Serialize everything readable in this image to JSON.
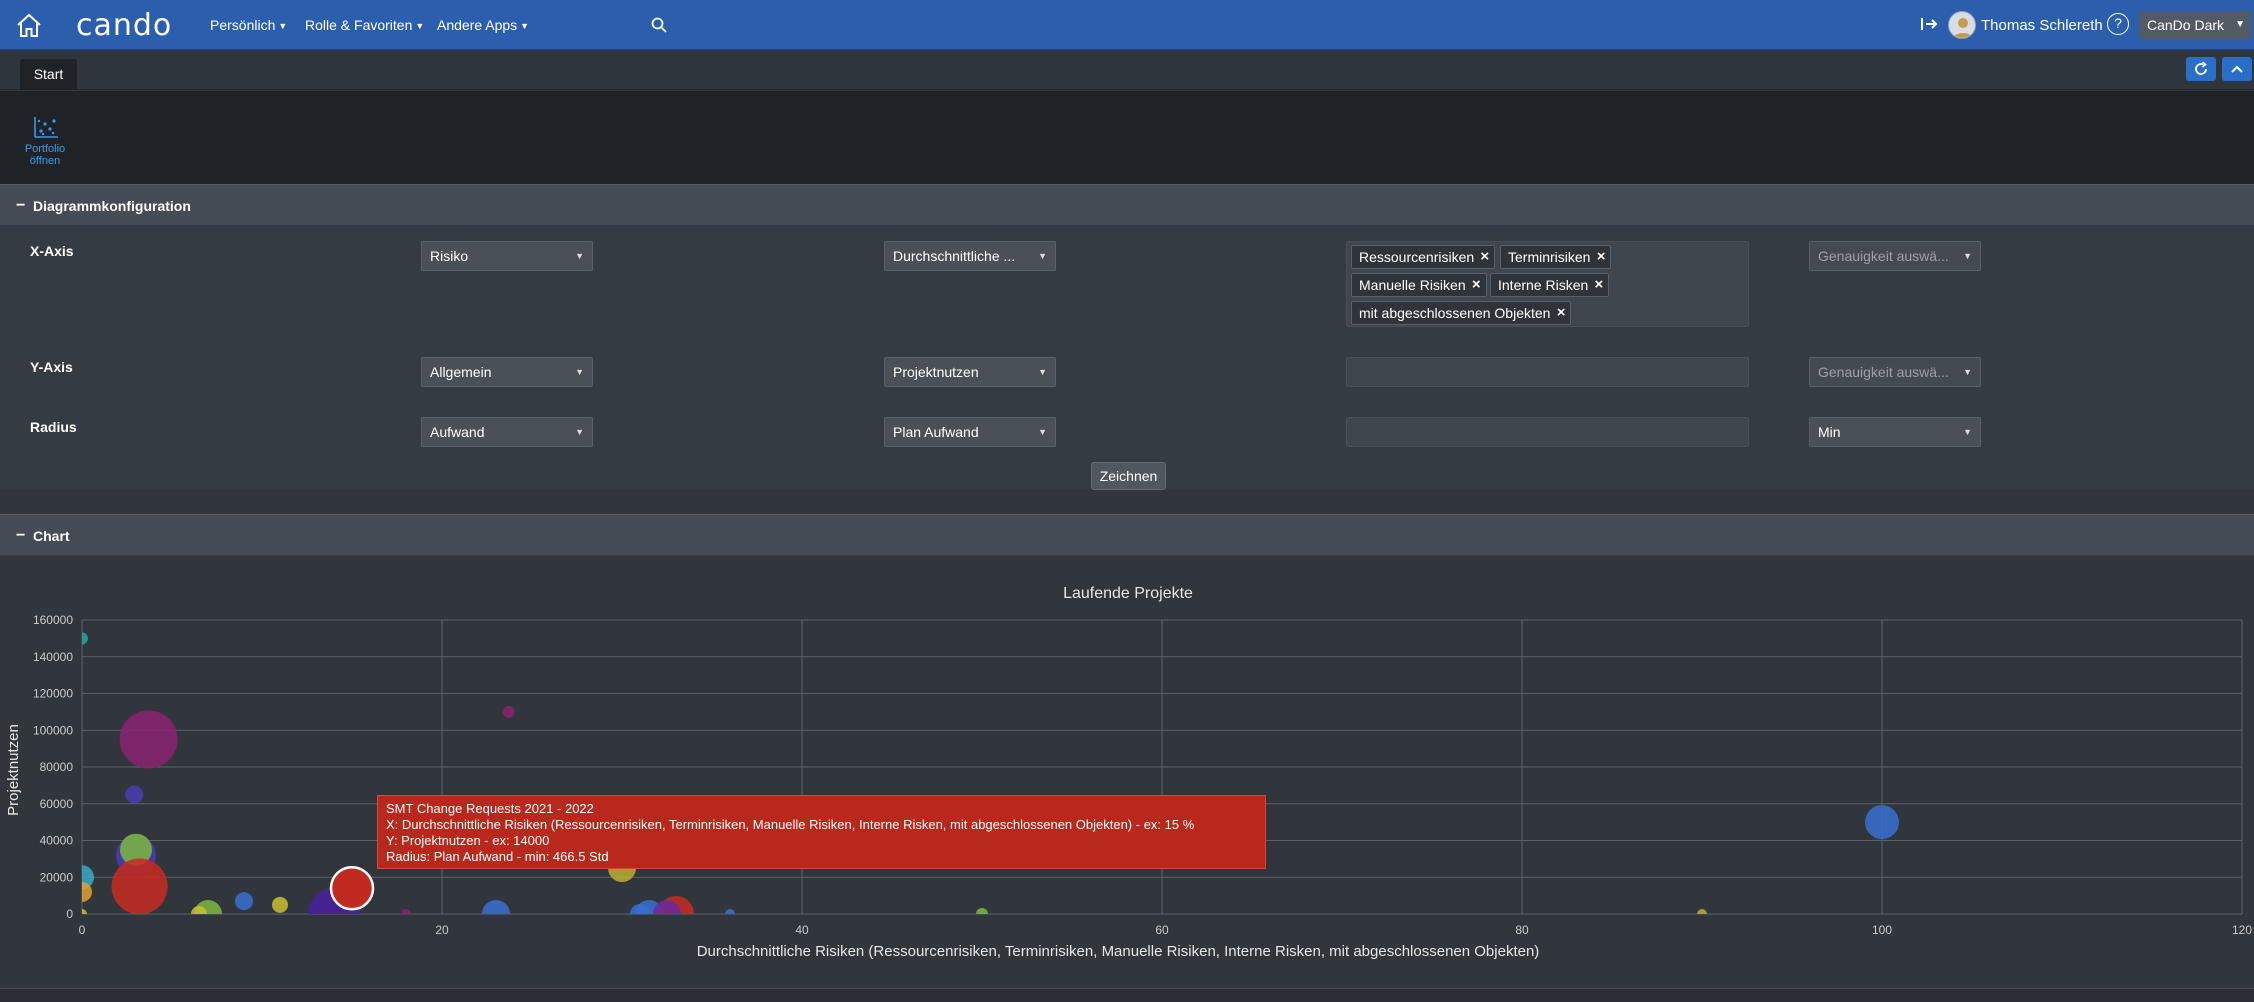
{
  "topbar": {
    "logo": "cando",
    "nav": [
      {
        "label": "Persönlich"
      },
      {
        "label": "Rolle & Favoriten"
      },
      {
        "label": "Andere Apps"
      }
    ],
    "user_name": "Thomas Schlereth",
    "help_glyph": "?",
    "theme_label": "CanDo Dark",
    "icons": [
      "home-icon",
      "search-icon",
      "logout-icon",
      "user-avatar-icon",
      "help-icon",
      "chevron-down-icon"
    ]
  },
  "tabs": [
    {
      "label": "Start"
    }
  ],
  "tabbar_icons": [
    "refresh-icon",
    "collapse-up-icon"
  ],
  "launcher": {
    "label_line1": "Portfolio",
    "label_line2": "öffnen",
    "icon": "scatter-chart-icon"
  },
  "config": {
    "title": "Diagrammkonfiguration",
    "collapse_glyph": "−",
    "rows": {
      "x": {
        "label": "X-Axis",
        "category": "Risiko",
        "metric": "Durchschnittliche ...",
        "tags": [
          "Ressourcenrisiken",
          "Terminrisiken",
          "Manuelle Risiken",
          "Interne Risken",
          "mit abgeschlossenen Objekten"
        ],
        "precision_placeholder": "Genauigkeit auswä..."
      },
      "y": {
        "label": "Y-Axis",
        "category": "Allgemein",
        "metric": "Projektnutzen",
        "precision_placeholder": "Genauigkeit auswä..."
      },
      "r": {
        "label": "Radius",
        "category": "Aufwand",
        "metric": "Plan Aufwand",
        "aggregation": "Min"
      }
    },
    "draw_button": "Zeichnen"
  },
  "chart_section": {
    "title": "Chart",
    "collapse_glyph": "−"
  },
  "chart_data": {
    "type": "scatter",
    "title": "Laufende Projekte",
    "xlabel": "Durchschnittliche Risiken (Ressourcenrisiken, Terminrisiken, Manuelle Risiken, Interne Risken, mit abgeschlossenen Objekten)",
    "ylabel": "Projektnutzen",
    "xlim": [
      0,
      120
    ],
    "ylim": [
      0,
      160000
    ],
    "xticks": [
      0,
      20,
      40,
      60,
      80,
      100,
      120
    ],
    "yticks": [
      0,
      20000,
      40000,
      60000,
      80000,
      100000,
      120000,
      140000,
      160000
    ],
    "grid": true,
    "points": [
      {
        "x": 0,
        "y": 150000,
        "r": 6,
        "color": "#2aa5a0"
      },
      {
        "x": 0,
        "y": 20000,
        "r": 12,
        "color": "#3aa8c8"
      },
      {
        "x": 0,
        "y": 12000,
        "r": 10,
        "color": "#e0a030"
      },
      {
        "x": 0,
        "y": 0,
        "r": 5,
        "color": "#c8c030"
      },
      {
        "x": 3.7,
        "y": 95000,
        "r": 29,
        "color": "#8a2270"
      },
      {
        "x": 2.9,
        "y": 65000,
        "r": 9,
        "color": "#4a3bb5"
      },
      {
        "x": 3,
        "y": 32000,
        "r": 20,
        "color": "#4a3bb5"
      },
      {
        "x": 3,
        "y": 35000,
        "r": 16,
        "color": "#7bb840"
      },
      {
        "x": 3.2,
        "y": 15000,
        "r": 28,
        "color": "#c82a20"
      },
      {
        "x": 7,
        "y": 0,
        "r": 14,
        "color": "#7bb840"
      },
      {
        "x": 6.5,
        "y": 0,
        "r": 8,
        "color": "#c8c030"
      },
      {
        "x": 9,
        "y": 7000,
        "r": 9,
        "color": "#3a6fd0"
      },
      {
        "x": 11,
        "y": 5000,
        "r": 8,
        "color": "#c8c030"
      },
      {
        "x": 14,
        "y": 0,
        "r": 26,
        "color": "#4a1fa0"
      },
      {
        "x": 15,
        "y": 14000,
        "r": 21,
        "color": "#c02a20",
        "highlight": true
      },
      {
        "x": 18,
        "y": 0,
        "r": 5,
        "color": "#8a2270"
      },
      {
        "x": 23.7,
        "y": 110000,
        "r": 6,
        "color": "#8a2270"
      },
      {
        "x": 23,
        "y": 0,
        "r": 14,
        "color": "#3a6fd0"
      },
      {
        "x": 30,
        "y": 25000,
        "r": 14,
        "color": "#b8b030"
      },
      {
        "x": 31,
        "y": 0,
        "r": 10,
        "color": "#3a6fd0"
      },
      {
        "x": 31.5,
        "y": 0,
        "r": 14,
        "color": "#3a6fd0"
      },
      {
        "x": 33,
        "y": 0,
        "r": 18,
        "color": "#c82a20"
      },
      {
        "x": 32.5,
        "y": 0,
        "r": 14,
        "color": "#6a2aa0"
      },
      {
        "x": 36,
        "y": 0,
        "r": 5,
        "color": "#3a6fd0"
      },
      {
        "x": 50,
        "y": 0,
        "r": 6,
        "color": "#7bb840"
      },
      {
        "x": 90,
        "y": 0,
        "r": 5,
        "color": "#b8b030"
      },
      {
        "x": 100,
        "y": 50000,
        "r": 17,
        "color": "#3a6fd0"
      }
    ],
    "tooltip": {
      "line1": "SMT Change Requests 2021 - 2022",
      "line2": "X: Durchschnittliche Risiken (Ressourcenrisiken, Terminrisiken, Manuelle Risiken, Interne Risken, mit abgeschlossenen Objekten) - ex: 15 %",
      "line3": "Y: Projektnutzen - ex: 14000",
      "line4": "Radius: Plan Aufwand - min: 466.5 Std"
    }
  }
}
